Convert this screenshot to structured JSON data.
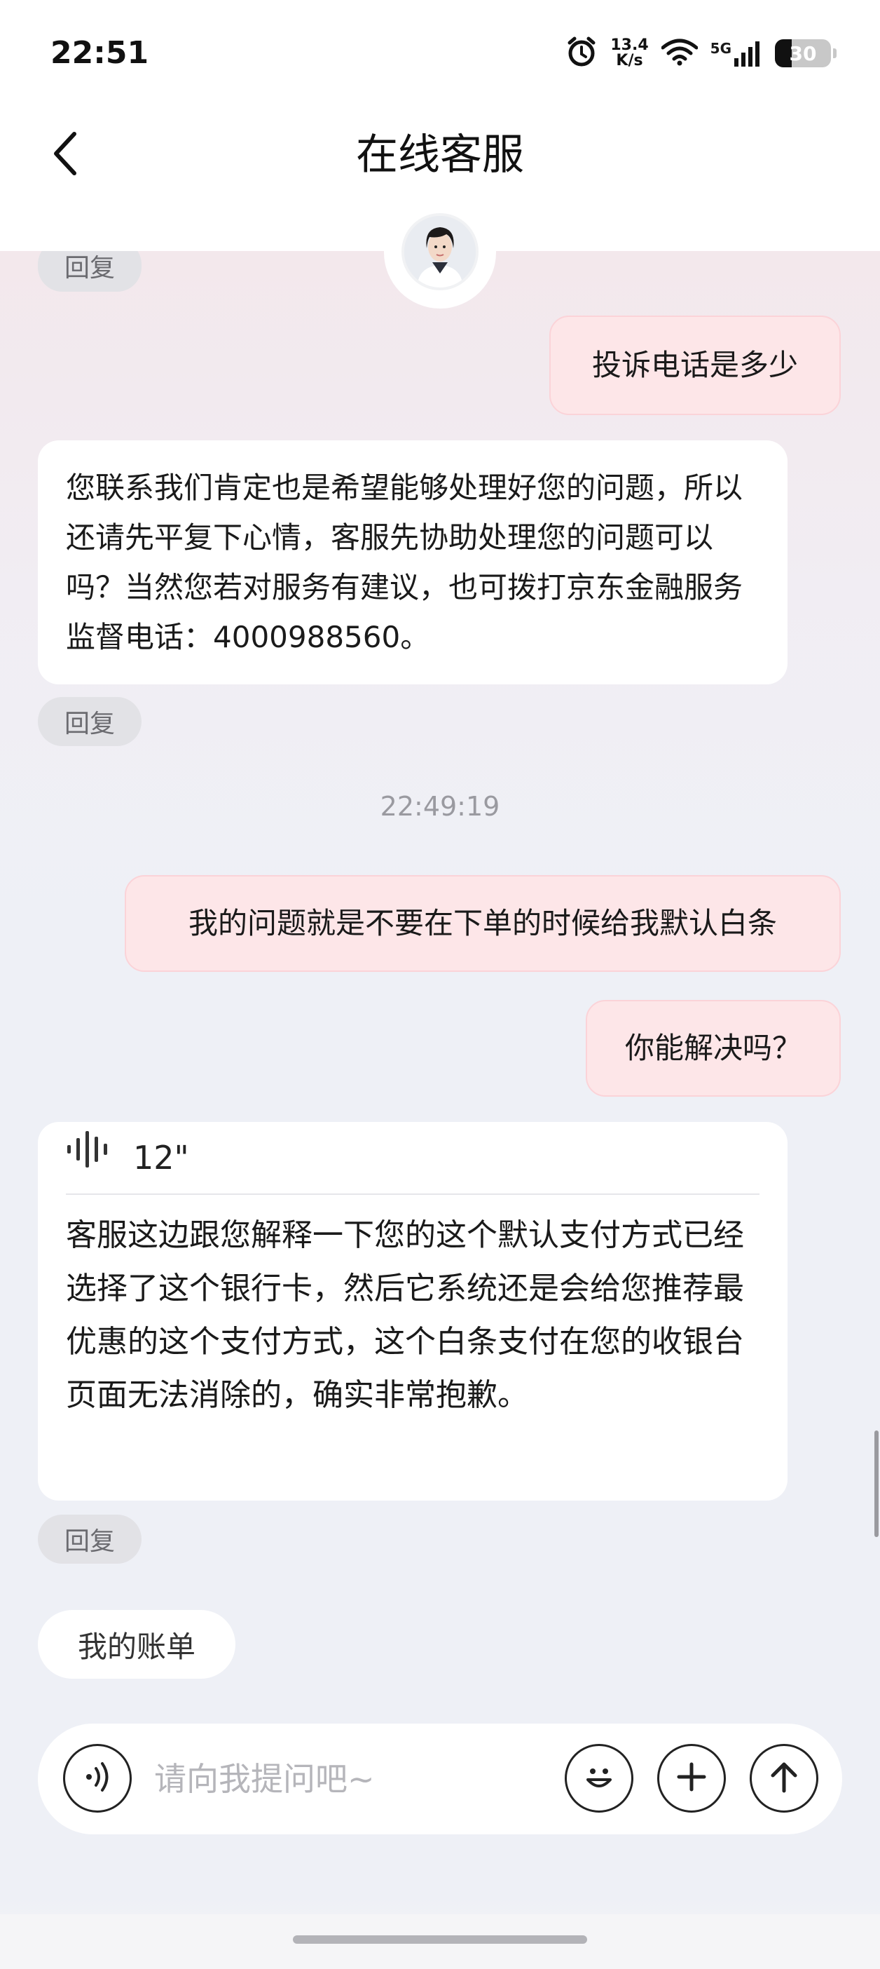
{
  "status_bar": {
    "time": "22:51",
    "net_speed_value": "13.4",
    "net_speed_unit": "K/s",
    "network_type": "5G",
    "battery": "30"
  },
  "header": {
    "title": "在线客服"
  },
  "messages": {
    "user_1": "投诉电话是多少",
    "agent_1": "您联系我们肯定也是希望能够处理好您的问题，所以还请先平复下心情，客服先协助处理您的问题可以吗？当然您若对服务有建议，也可拨打京东金融服务监督电话：4000988560。",
    "timestamp": "22:49:19",
    "user_2": "我的问题就是不要在下单的时候给我默认白条",
    "user_3": "你能解决吗？",
    "agent_2_voice_duration": "12\"",
    "agent_2": "客服这边跟您解释一下您的这个默认支付方式已经选择了这个银行卡，然后它系统还是会给您推荐最优惠的这个支付方式，这个白条支付在您的收银台页面无法消除的，确实非常抱歉。"
  },
  "reply_label": "回复",
  "quick_action": "我的账单",
  "input": {
    "placeholder": "请向我提问吧~"
  },
  "colors": {
    "user_bubble": "#fde6e8",
    "agent_bubble": "#ffffff",
    "accent_text": "#1a1a1a"
  }
}
